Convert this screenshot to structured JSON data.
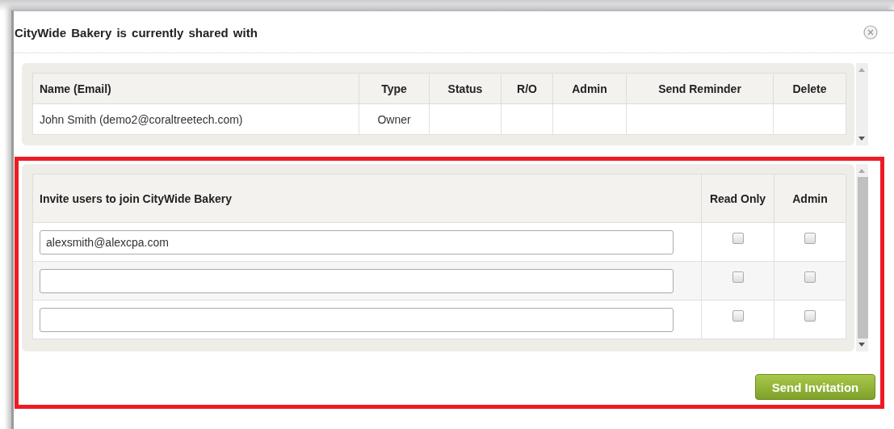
{
  "dialog": {
    "title": "CityWide Bakery is currently shared with"
  },
  "shared_table": {
    "columns": [
      "Name (Email)",
      "Type",
      "Status",
      "R/O",
      "Admin",
      "Send Reminder",
      "Delete"
    ],
    "rows": [
      {
        "name_email": "John Smith (demo2@coraltreetech.com)",
        "type": "Owner"
      }
    ]
  },
  "invite_table": {
    "columns": [
      "Invite users to join CityWide Bakery",
      "Read Only",
      "Admin"
    ],
    "rows": [
      {
        "email": "alexsmith@alexcpa.com",
        "read_only": false,
        "admin": false
      },
      {
        "email": "",
        "read_only": false,
        "admin": false
      },
      {
        "email": "",
        "read_only": false,
        "admin": false
      }
    ]
  },
  "send_button": "Send Invitation"
}
